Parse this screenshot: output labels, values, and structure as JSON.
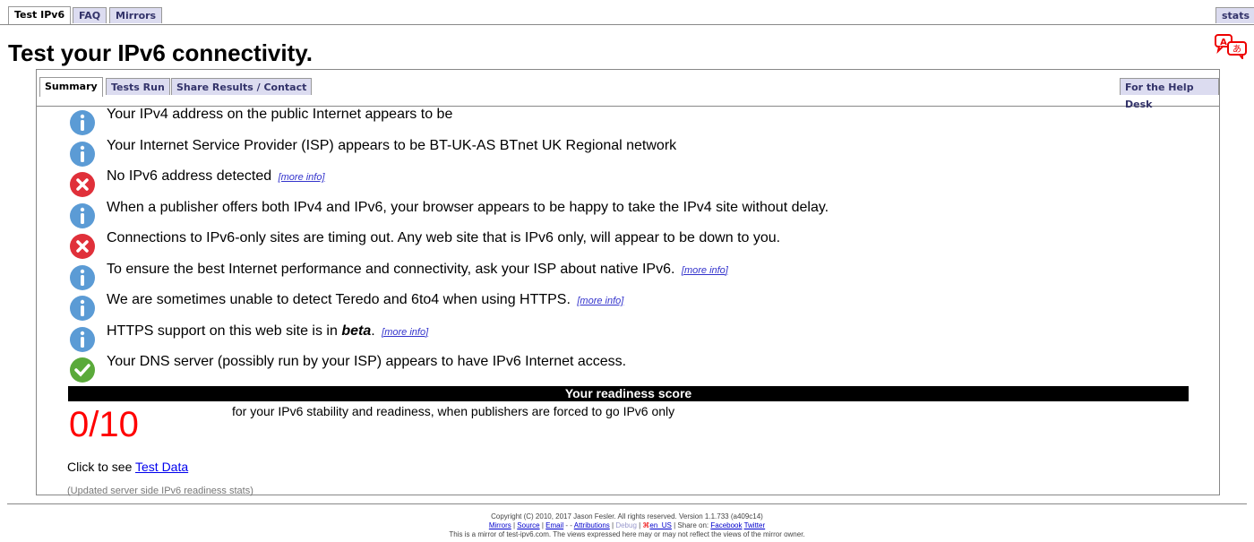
{
  "top_tabs": [
    "Test IPv6",
    "FAQ",
    "Mirrors"
  ],
  "stats_tab": "stats",
  "title": "Test your IPv6 connectivity.",
  "inner_tabs": [
    "Summary",
    "Tests Run",
    "Share Results / Contact"
  ],
  "help_desk_tab": "For the Help Desk",
  "more_info": "[more info]",
  "results": [
    {
      "status": "info",
      "text": "Your IPv4 address on the public Internet appears to be",
      "more": false
    },
    {
      "status": "info",
      "text": "Your Internet Service Provider (ISP) appears to be BT-UK-AS BTnet UK Regional network",
      "more": false
    },
    {
      "status": "error",
      "text": "No IPv6 address detected",
      "more": true
    },
    {
      "status": "info",
      "text": "When a publisher offers both IPv4 and IPv6, your browser appears to be happy to take the IPv4 site without delay.",
      "more": false
    },
    {
      "status": "error",
      "text": "Connections to IPv6-only sites are timing out. Any web site that is IPv6 only, will appear to be down to you.",
      "more": false
    },
    {
      "status": "info",
      "text": "To ensure the best Internet performance and connectivity, ask your ISP about native IPv6.",
      "more": true
    },
    {
      "status": "info",
      "text": "We are sometimes unable to detect Teredo and 6to4 when using HTTPS.",
      "more": true
    },
    {
      "status": "info",
      "text": "HTTPS support on this web site is in",
      "em": "beta",
      "suffix": ".",
      "more": true
    },
    {
      "status": "ok",
      "text": "Your DNS server (possibly run by your ISP) appears to have IPv6 Internet access.",
      "more": false
    }
  ],
  "readiness_header": "Your readiness score",
  "score": "0/10",
  "score_desc": "for your IPv6 stability and readiness, when publishers are forced to go IPv6 only",
  "click_prefix": "Click to see",
  "test_data_link": "Test Data",
  "updated_stats": "(Updated server side IPv6 readiness stats)",
  "footer": {
    "copyright": "Copyright (C) 2010, 2017 Jason Fesler. All rights reserved. Version 1.1.733 (a409c14)",
    "links": [
      "Mirrors",
      "Source",
      "Email",
      "Attributions",
      "Debug",
      "en_US"
    ],
    "share_on": "Share on:",
    "share_links": [
      "Facebook",
      "Twitter"
    ],
    "mirror_note": "This is a mirror of test-ipv6.com. The views expressed here may or may not reflect the views of the mirror owner."
  },
  "colors": {
    "info": "#5b9bd5",
    "error": "#e0303a",
    "ok": "#5aaa3a",
    "score": "#ff0000"
  }
}
